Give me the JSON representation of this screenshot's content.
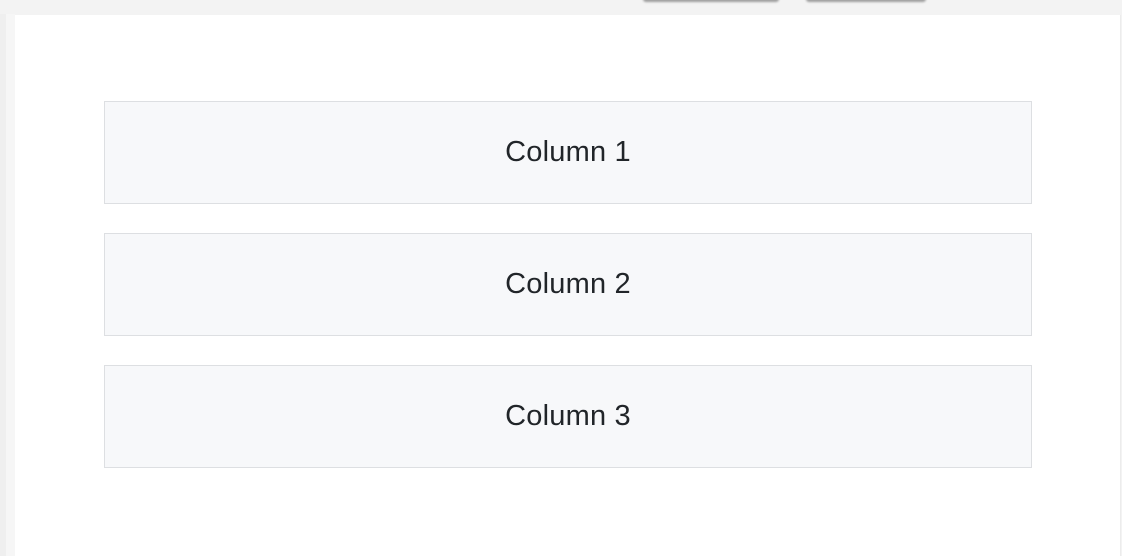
{
  "columns": [
    {
      "label": "Column 1"
    },
    {
      "label": "Column 2"
    },
    {
      "label": "Column 3"
    }
  ],
  "colors": {
    "page_background": "#f3f3f3",
    "content_background": "#ffffff",
    "column_background": "#f7f8fa",
    "column_border": "#dddfe2",
    "text": "#212529"
  }
}
